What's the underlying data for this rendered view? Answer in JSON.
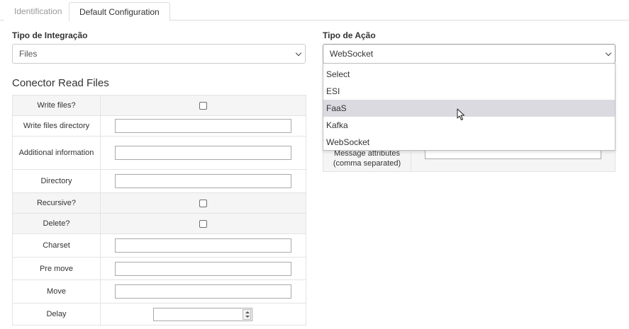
{
  "tabs": [
    {
      "label": "Identification",
      "active": false
    },
    {
      "label": "Default Configuration",
      "active": true
    }
  ],
  "integration": {
    "label": "Tipo de Integração",
    "value": "Files"
  },
  "action": {
    "label": "Tipo de Ação",
    "value": "WebSocket",
    "options": [
      "Select",
      "ESI",
      "FaaS",
      "Kafka",
      "WebSocket"
    ],
    "hovered": "FaaS"
  },
  "connector": {
    "title": "Conector Read Files",
    "rows": [
      {
        "label": "Write files?",
        "type": "checkbox"
      },
      {
        "label": "Write files directory",
        "type": "text"
      },
      {
        "label": "Additional information",
        "type": "text"
      },
      {
        "label": "Directory",
        "type": "text"
      },
      {
        "label": "Recursive?",
        "type": "checkbox"
      },
      {
        "label": "Delete?",
        "type": "checkbox"
      },
      {
        "label": "Charset",
        "type": "text"
      },
      {
        "label": "Pre move",
        "type": "text"
      },
      {
        "label": "Move",
        "type": "text"
      },
      {
        "label": "Delay",
        "type": "number"
      }
    ]
  },
  "right_table": {
    "row_label": "Message attributes (comma separated)"
  },
  "icons": {
    "select_arrow": "chevron-down-icon",
    "spinner": "spinner-arrows-icon",
    "cursor": "mouse-pointer-icon"
  }
}
